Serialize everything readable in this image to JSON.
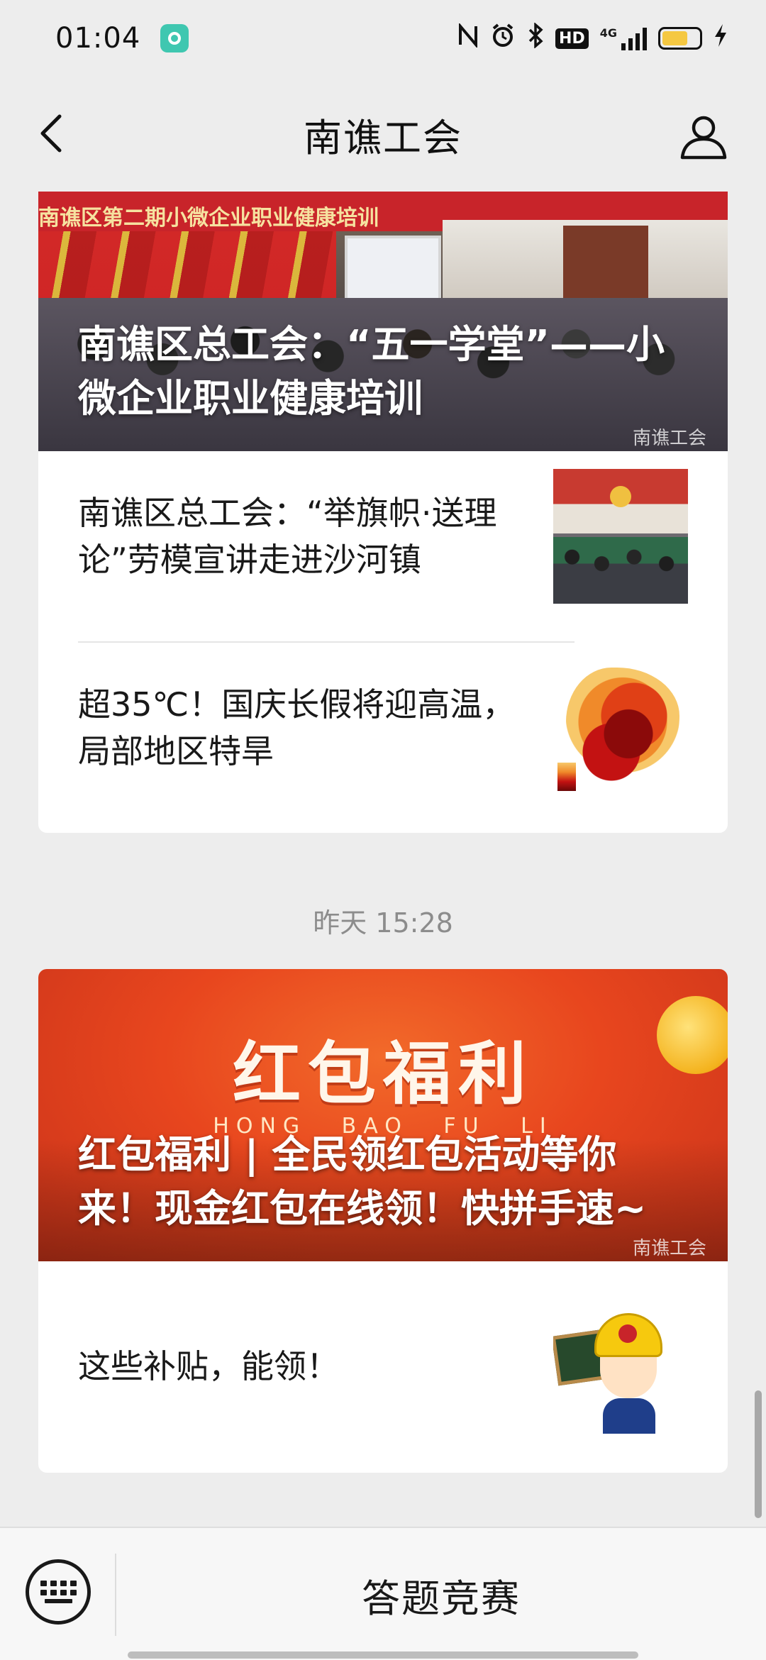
{
  "status_bar": {
    "time": "01:04",
    "icons": [
      "app-icon",
      "nfc-icon",
      "alarm-icon",
      "bluetooth-icon",
      "hd-icon",
      "signal-4g-icon",
      "battery-icon",
      "charging-icon"
    ],
    "hd": "HD",
    "network": "4G"
  },
  "nav": {
    "title": "南谯工会"
  },
  "articles_group_1": {
    "hero": {
      "banner_text": "南谯区第二期小微企业职业健康培训",
      "title": "南谯区总工会：“五一学堂”——小微企业职业健康培训",
      "watermark": "南谯工会"
    },
    "items": [
      {
        "title": "南谯区总工会：“举旗帜·送理论”劳模宣讲走进沙河镇"
      },
      {
        "title": "超35℃！国庆长假将迎高温，局部地区特旱"
      }
    ]
  },
  "timestamp": "昨天 15:28",
  "articles_group_2": {
    "hero": {
      "big_text": "红包福利",
      "pinyin": "HONG BAO FU LI",
      "title": "红包福利 | 全民领红包活动等你来！现金红包在线领！快拼手速~",
      "watermark": "南谯工会"
    },
    "items": [
      {
        "title": "这些补贴，能领！"
      }
    ]
  },
  "bottom_menu": {
    "item": "答题竞赛"
  },
  "colors": {
    "background": "#ededed",
    "card": "#ffffff",
    "red_banner": "#e8461e",
    "muted_text": "#8c8c8c"
  }
}
